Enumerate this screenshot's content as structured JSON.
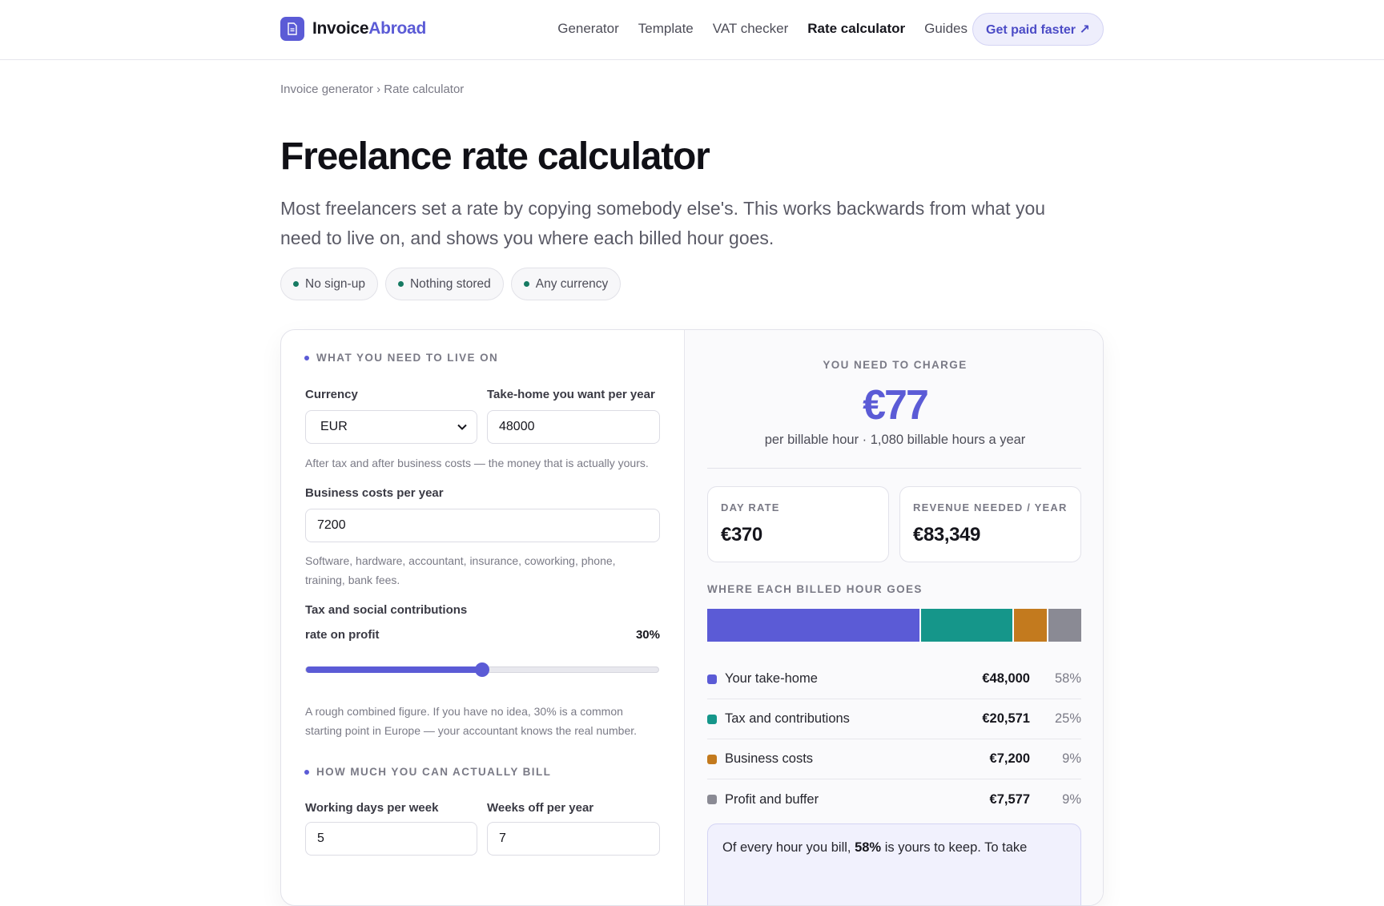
{
  "brand": {
    "name_a": "Invoice",
    "name_b": "Abroad",
    "accent": "#5b5bd6"
  },
  "nav": {
    "items": [
      {
        "label": "Generator",
        "active": false
      },
      {
        "label": "Template",
        "active": false
      },
      {
        "label": "VAT checker",
        "active": false
      },
      {
        "label": "Rate calculator",
        "active": true
      },
      {
        "label": "Guides",
        "active": false
      }
    ],
    "cta": "Get paid faster ↗"
  },
  "breadcrumb": "Invoice generator › Rate calculator",
  "hero": {
    "title": "Freelance rate calculator",
    "lede": "Most freelancers set a rate by copying somebody else's. This works backwards from what you need to live on, and shows you where each billed hour goes.",
    "pills": [
      "No sign-up",
      "Nothing stored",
      "Any currency"
    ]
  },
  "form": {
    "section1": "WHAT YOU NEED TO LIVE ON",
    "currency_label": "Currency",
    "currency_value": "EUR",
    "takehome_label": "Take-home you want per year",
    "takehome_value": "48000",
    "takehome_help": "After tax and after business costs — the money that is actually yours.",
    "costs_label": "Business costs per year",
    "costs_value": "7200",
    "costs_help_1": "Software, hardware, accountant, insurance, coworking, phone,",
    "costs_help_2": "training, bank fees.",
    "tax_label": "Tax and social contributions",
    "tax_sub": "rate on profit",
    "tax_value_text": "30%",
    "tax_fraction": 0.5,
    "tax_help_1": "A rough combined figure. If you have no idea, 30% is a common",
    "tax_help_2": "starting point in Europe — your accountant knows the real number.",
    "section2": "HOW MUCH YOU CAN ACTUALLY BILL",
    "days_label": "Working days per week",
    "days_value": "5",
    "weeks_label": "Weeks off per year",
    "weeks_value": "7"
  },
  "result": {
    "eyebrow": "YOU NEED TO CHARGE",
    "rate": "€77",
    "sub": "per billable hour · 1,080 billable hours a year",
    "day_label": "DAY RATE",
    "day_value": "€370",
    "rev_label": "REVENUE NEEDED / YEAR",
    "rev_value": "€83,349",
    "breakdown_label": "WHERE EACH BILLED HOUR GOES",
    "breakdown": [
      {
        "name": "Your take-home",
        "amount": "€48,000",
        "pct": "58%",
        "share": 58,
        "color": "#5b5bd6"
      },
      {
        "name": "Tax and contributions",
        "amount": "€20,571",
        "pct": "25%",
        "share": 25,
        "color": "#15968a"
      },
      {
        "name": "Business costs",
        "amount": "€7,200",
        "pct": "9%",
        "share": 9,
        "color": "#c37a1e"
      },
      {
        "name": "Profit and buffer",
        "amount": "€7,577",
        "pct": "9%",
        "share": 9,
        "color": "#8a8a94"
      }
    ],
    "note_a": "Of every hour you bill, ",
    "note_b": "58%",
    "note_c": " is yours to keep. To take"
  }
}
